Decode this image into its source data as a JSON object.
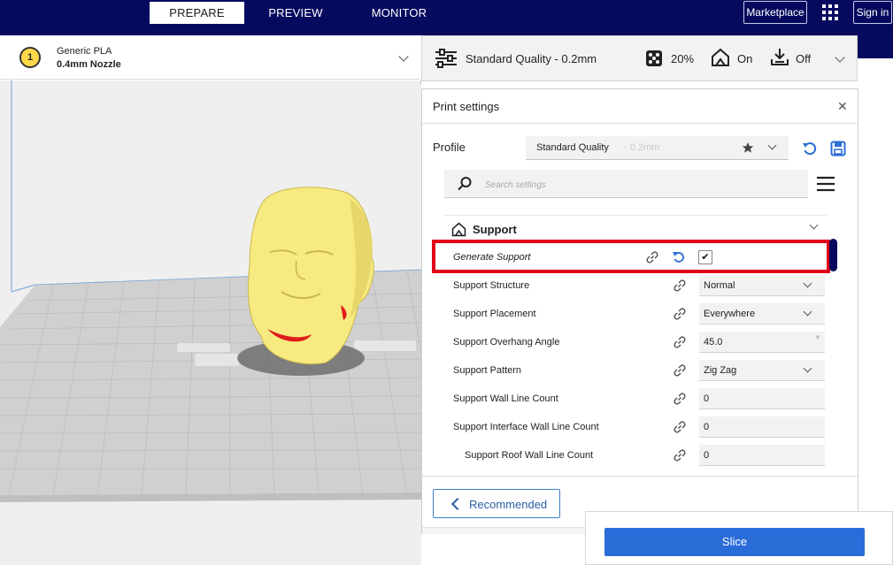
{
  "topbar": {
    "tabs": [
      {
        "label": "PREPARE",
        "active": true
      },
      {
        "label": "PREVIEW",
        "active": false
      },
      {
        "label": "MONITOR",
        "active": false
      }
    ],
    "marketplace_label": "Marketplace",
    "signin_label": "Sign in",
    "apps_icon": "grid-icon"
  },
  "printer": {
    "extruder_number": "1",
    "material": "Generic PLA",
    "nozzle": "0.4mm Nozzle"
  },
  "quality_bar": {
    "profile": "Standard Quality - 0.2mm",
    "infill": "20%",
    "support": "On",
    "adhesion": "Off"
  },
  "print_settings": {
    "title": "Print settings",
    "profile_label": "Profile",
    "profile_name": "Standard Quality",
    "profile_layer": "- 0.2mm",
    "search_placeholder": "Search settings",
    "section_title": "Support",
    "rows": [
      {
        "label": "Generate Support",
        "value": "",
        "type": "checkbox",
        "checked": true
      },
      {
        "label": "Support Structure",
        "value": "Normal",
        "type": "select"
      },
      {
        "label": "Support Placement",
        "value": "Everywhere",
        "type": "select"
      },
      {
        "label": "Support Overhang Angle",
        "value": "45.0",
        "type": "number",
        "unit": "°"
      },
      {
        "label": "Support Pattern",
        "value": "Zig Zag",
        "type": "select"
      },
      {
        "label": "Support Wall Line Count",
        "value": "0",
        "type": "number"
      },
      {
        "label": "Support Interface Wall Line Count",
        "value": "0",
        "type": "number"
      },
      {
        "label": "Support Roof Wall Line Count",
        "value": "0",
        "type": "number"
      }
    ],
    "recommended_label": "Recommended"
  },
  "slice_label": "Slice",
  "colors": {
    "topbar": "#060a5e",
    "accent_blue": "#2a6cd8",
    "highlight_red": "#e0001a",
    "model_yellow": "#f6ea80"
  }
}
